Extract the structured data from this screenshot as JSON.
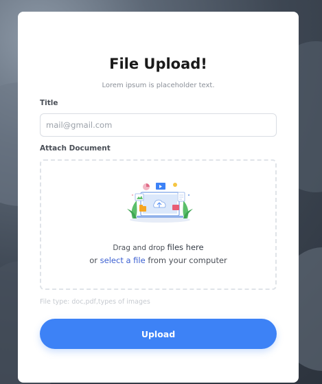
{
  "card": {
    "title": "File Upload!",
    "subtitle": "Lorem ipsum is placeholder text."
  },
  "form": {
    "title_label": "Title",
    "title_placeholder": "mail@gmail.com",
    "title_value": "",
    "attach_label": "Attach Document",
    "drop_text_small": "Drag and drop ",
    "drop_text_big": "files here",
    "drop_or": "or ",
    "drop_link": "select a file",
    "drop_suffix": " from your computer",
    "file_type_hint": "File type: doc,pdf,types of images",
    "upload_label": "Upload"
  },
  "icons": {
    "illustration": "upload-illustration-icon"
  },
  "colors": {
    "accent": "#3d82f6",
    "link": "#3b5fd1",
    "card_bg": "#ffffff"
  }
}
